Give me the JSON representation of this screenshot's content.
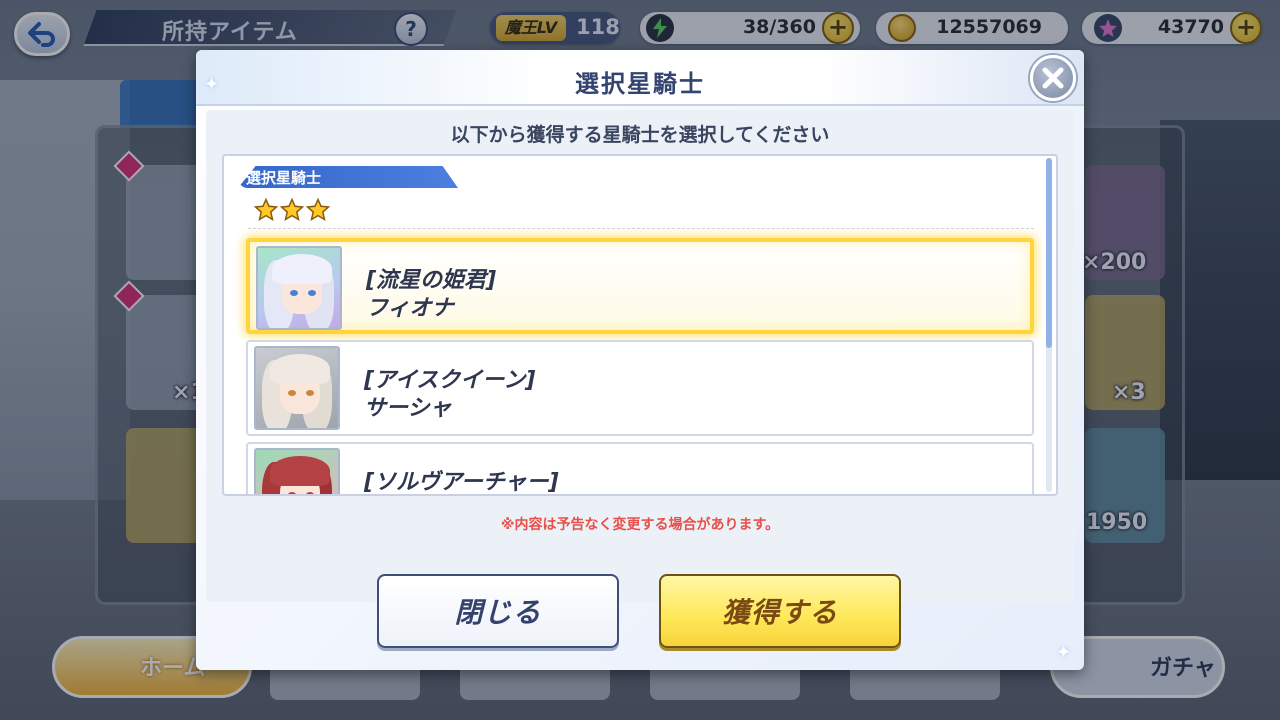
{
  "topbar": {
    "page_title": "所持アイテム",
    "help": "?",
    "level_label": "魔王LV",
    "level_value": "118",
    "stamina": "38/360",
    "coins": "12557069",
    "gems": "43770",
    "plus": "+"
  },
  "background": {
    "counts": [
      "×200",
      "×3",
      "1950",
      "×1"
    ]
  },
  "bottom_nav": {
    "home_label": "ホーム",
    "gacha_label": "ガチャ"
  },
  "dialog": {
    "title": "選択星騎士",
    "instruction": "以下から獲得する星騎士を選択してください",
    "section_label": "選択星騎士",
    "rarity_stars": 3,
    "characters": [
      {
        "title": "[流星の姫君]",
        "name": "フィオナ",
        "selected": true
      },
      {
        "title": "[アイスクイーン]",
        "name": "サーシャ",
        "selected": false
      },
      {
        "title": "[ソルヴアーチャー]",
        "name": "",
        "selected": false
      }
    ],
    "notice": "※内容は予告なく変更する場合があります。",
    "close_button": "閉じる",
    "obtain_button": "獲得する"
  },
  "colors": {
    "accent_blue": "#3567c9",
    "selected_glow": "#ffd43c",
    "obtain_button": "#ffe95e",
    "notice_red": "#e8504a"
  },
  "icons": [
    "back-arrow-icon",
    "help-icon",
    "stamina-bolt-icon",
    "coin-icon",
    "gem-icon",
    "plus-icon",
    "close-x-icon",
    "star-icon",
    "sparkle-icon"
  ]
}
